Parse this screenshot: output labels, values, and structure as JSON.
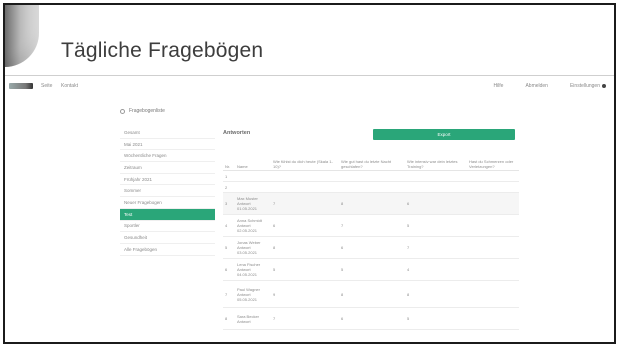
{
  "slide": {
    "title": "Tägliche Fragebögen"
  },
  "app": {
    "nav": [
      "Seite",
      "Kontakt"
    ],
    "topbar_right": [
      "Hilfe",
      "Abmelden",
      "Einstellungen"
    ]
  },
  "sidebar": {
    "heading": "Fragebogenliste",
    "items": [
      {
        "label": "Gesamt"
      },
      {
        "label": "Mai 2021"
      },
      {
        "label": "Wöchentliche Fragen"
      },
      {
        "label": "Zeitraum"
      },
      {
        "label": "Frühjahr 2021"
      },
      {
        "label": "Sommer"
      },
      {
        "label": "Neuer Fragebogen"
      },
      {
        "label": "Test",
        "active": true
      },
      {
        "label": "Sportler"
      },
      {
        "label": "Gesundheit"
      },
      {
        "label": "Alle Fragebögen"
      }
    ]
  },
  "content": {
    "title": "Antworten",
    "export_button": "Export",
    "columns": [
      "Nr.",
      "Name",
      "Wie fühlst du dich heute (Skala 1-10)?",
      "Wie gut hast du letzte Nacht geschlafen?",
      "Wie intensiv war dein letztes Training?",
      "Hast du Schmerzen oder Verletzungen?"
    ],
    "rows": [
      {
        "nr": "1",
        "name": "",
        "c1": "",
        "c2": "",
        "c3": "",
        "c4": ""
      },
      {
        "nr": "2",
        "name": "",
        "c1": "",
        "c2": "",
        "c3": "",
        "c4": ""
      },
      {
        "nr": "3",
        "name": "Max Muster Antwort 01.05.2021",
        "c1": "7",
        "c2": "8",
        "c3": "6",
        "c4": ""
      },
      {
        "nr": "4",
        "name": "Anna Schmidt Antwort 02.05.2021",
        "c1": "6",
        "c2": "7",
        "c3": "5",
        "c4": ""
      },
      {
        "nr": "5",
        "name": "Jonas Weber Antwort 03.05.2021",
        "c1": "8",
        "c2": "6",
        "c3": "7",
        "c4": ""
      },
      {
        "nr": "6",
        "name": "Lena Fischer Antwort 04.05.2021",
        "c1": "5",
        "c2": "5",
        "c3": "4",
        "c4": ""
      },
      {
        "nr": "7",
        "name": "Paul Wagner Antwort 05.05.2021",
        "c1": "9",
        "c2": "8",
        "c3": "8",
        "c4": ""
      },
      {
        "nr": "8",
        "name": "Sara Becker Antwort",
        "c1": "7",
        "c2": "6",
        "c3": "5",
        "c4": ""
      }
    ]
  }
}
